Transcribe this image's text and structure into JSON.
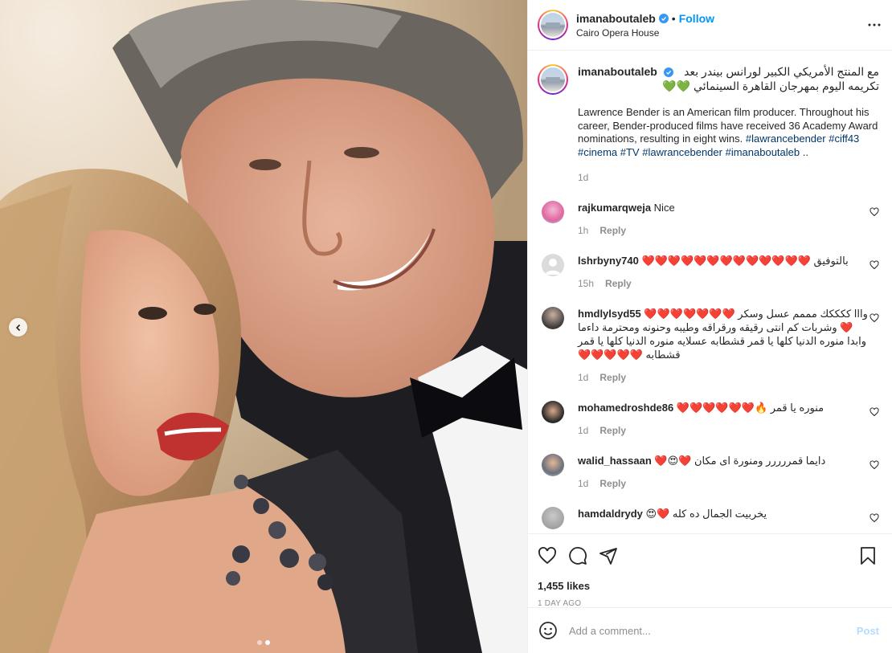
{
  "post": {
    "username": "imanaboutaleb",
    "follow_label": "Follow",
    "separator": "•",
    "location": "Cairo Opera House",
    "caption_ar": "مع المنتج الأمريكي الكبير لورانس بيندر بعد تكريمه اليوم بمهرجان القاهرة السينمائي 💚💚",
    "caption_en": "Lawrence Bender is an American film producer. Throughout his career, Bender-produced films have received 36 Academy Award nominations, resulting in eight wins.",
    "hashtags": [
      "#lawrancebender",
      "#ciff43",
      "#cinema",
      "#TV",
      "#lawrancebender",
      "#imanaboutaleb"
    ],
    "caption_suffix": "..",
    "caption_time": "1d",
    "likes": "1,455 likes",
    "date": "1 DAY AGO",
    "comment_placeholder": "Add a comment...",
    "post_label": "Post",
    "image_dots": 2,
    "image_active_dot": 2
  },
  "comments": [
    {
      "user": "rajkumarqweja",
      "text": "Nice",
      "time": "1h",
      "reply": "Reply",
      "avatar": "pink"
    },
    {
      "user": "lshrbyny740",
      "text": "بالتوفيق ❤️❤️❤️❤️❤️❤️❤️❤️❤️❤️❤️❤️❤️",
      "time": "15h",
      "reply": "Reply",
      "avatar": "default"
    },
    {
      "user": "hmdlylsyd55",
      "text": "وااا ككككك مممم عسل وسكر ❤️❤️❤️❤️❤️❤️❤️❤️ وشربات كم انتى رقيقه ورقراقه وطيبه وحنونه ومحترمة داءما وابدا منوره الدنيا كلها يا قمر قشطابه عسلايه منوره الدنيا كلها يا قمر قشطابه ❤️❤️❤️❤️❤️",
      "time": "1d",
      "reply": "Reply",
      "avatar": "dark-man"
    },
    {
      "user": "mohamedroshde86",
      "text": "منوره يا قمر 🔥❤️❤️❤️❤️❤️❤️",
      "time": "1d",
      "reply": "Reply",
      "avatar": "dark-woman"
    },
    {
      "user": "walid_hassaan",
      "text": "دايما قمررررر ومنورة اى مكان ❤️😍❤️",
      "time": "1d",
      "reply": "Reply",
      "avatar": "man"
    },
    {
      "user": "hamdaldrydy",
      "text": "يخربيت الجمال ده كله ❤️😍",
      "time": "",
      "reply": "",
      "avatar": "grey"
    }
  ],
  "colors": {
    "link_blue": "#0095f6",
    "hashtag": "#00376b",
    "muted": "#8e8e8e",
    "post_disabled": "#b3dbff"
  },
  "icons": [
    "chevron-left-icon",
    "more-icon",
    "verified-badge-icon",
    "heart-icon",
    "comment-icon",
    "share-icon",
    "bookmark-icon",
    "emoji-icon"
  ]
}
